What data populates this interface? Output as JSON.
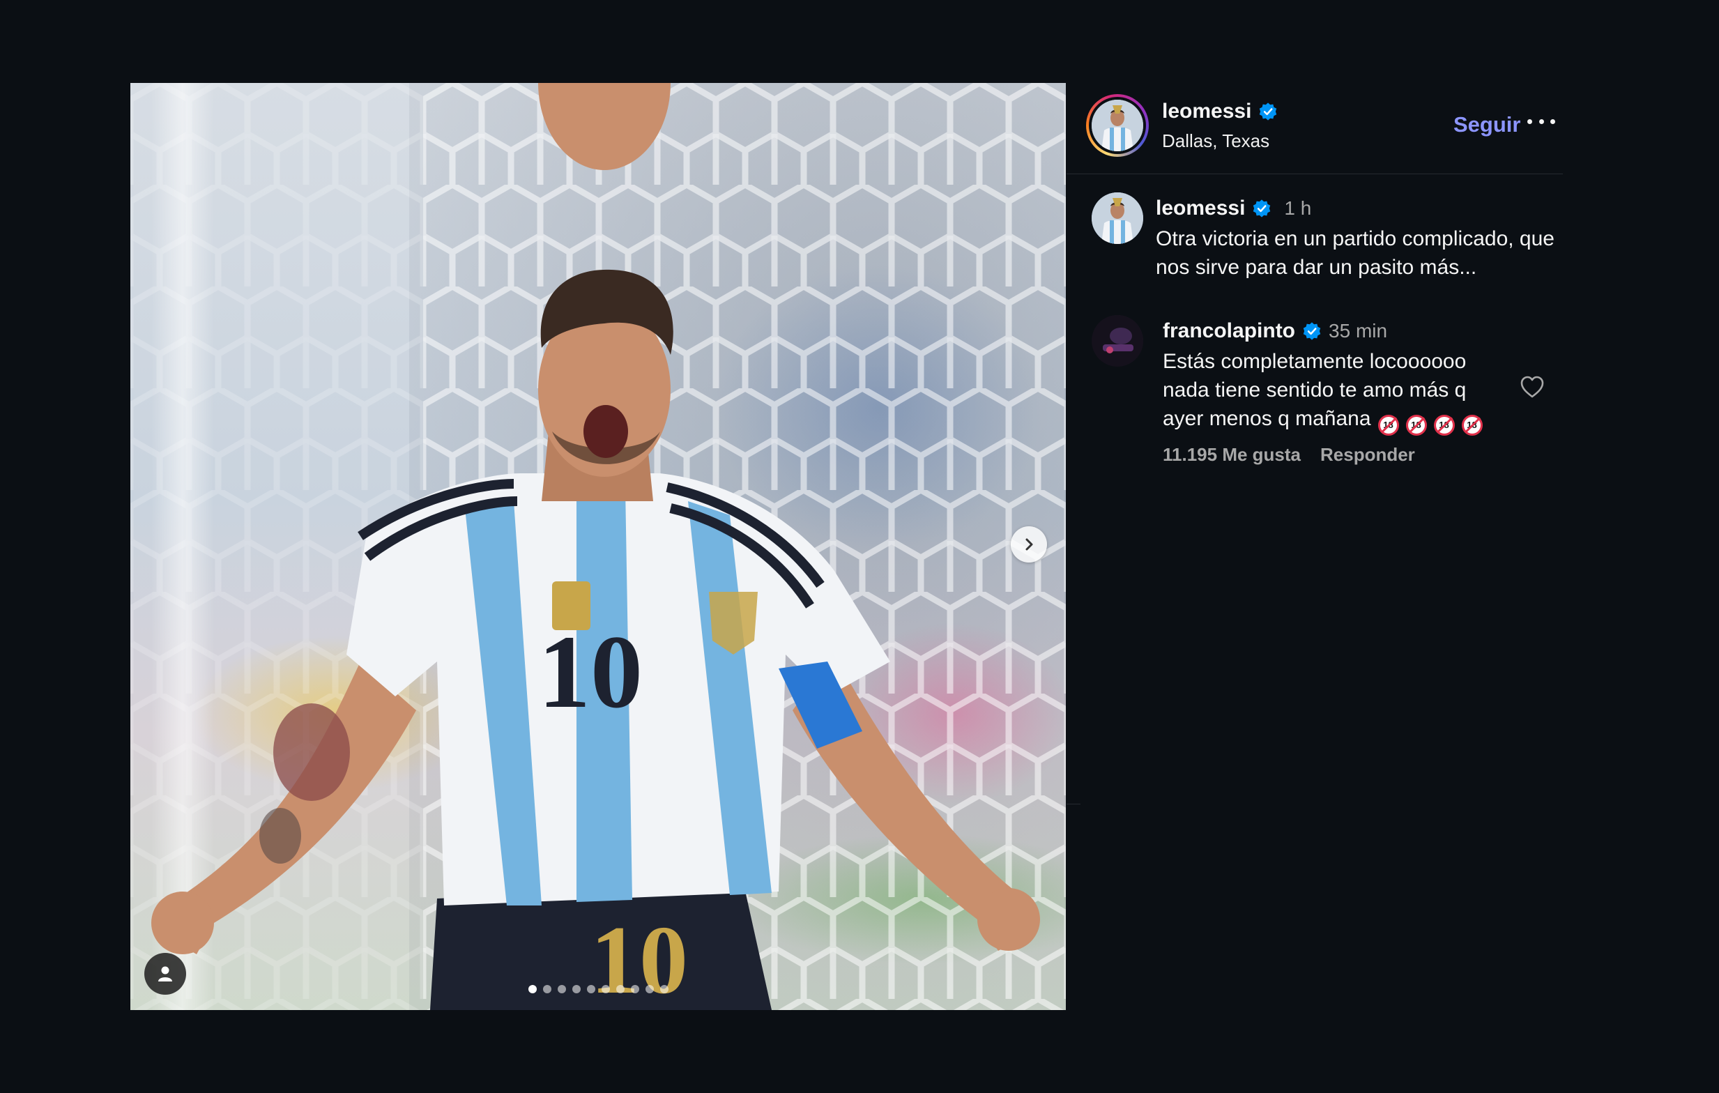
{
  "post": {
    "author": {
      "username": "leomessi",
      "verified": true,
      "location": "Dallas, Texas"
    },
    "follow_label": "Seguir",
    "more_label": "...",
    "carousel": {
      "current_slide": 1,
      "total_slides": 10
    },
    "caption": {
      "username": "leomessi",
      "time": "1 h",
      "text": "Otra victoria en un partido complicado, que nos sirve para dar un pasito más..."
    },
    "comments": [
      {
        "username": "francolapinto",
        "verified": true,
        "time": "35 min",
        "text": "Estás completamente locoooooo nada tiene sentido te amo más q ayer menos q mañana",
        "emoji_text": "🔞🔞🔞🔞",
        "emoji_count": 4,
        "likes_label": "11.195 Me gusta",
        "reply_label": "Responder"
      }
    ]
  },
  "colors": {
    "background": "#0b0f14",
    "accent_link": "#8c95ff",
    "verified_blue": "#0095f6",
    "muted_text": "#a8a8a8"
  },
  "icons": {
    "verified": "verified-badge-icon",
    "next": "chevron-right-icon",
    "tag": "user-tag-icon",
    "like": "heart-outline-icon",
    "more": "more-horizontal-icon"
  }
}
